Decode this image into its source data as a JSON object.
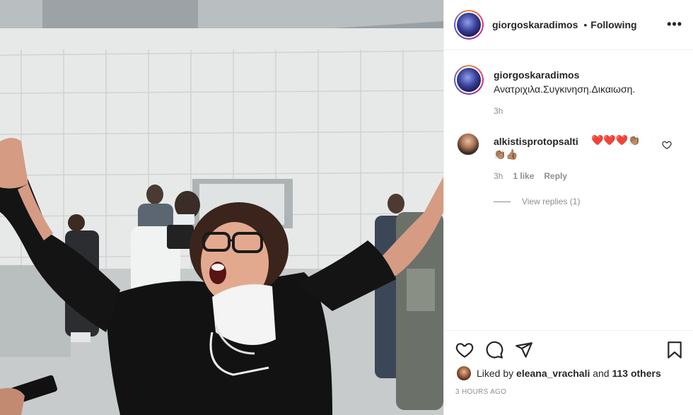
{
  "post": {
    "author": "giorgoskaradimos",
    "separator": "•",
    "follow_status": "Following",
    "more_icon": "more-horizontal-icon"
  },
  "caption": {
    "username": "giorgoskaradimos",
    "text": "Ανατριχιλα.Συγκινηση.Δικαιωση.",
    "time": "3h"
  },
  "comment": {
    "username": "alkistisprotopsalti",
    "text_line1": "❤️❤️❤️👏🏽",
    "text_line2": "👏🏽👍🏽",
    "time": "3h",
    "likes": "1 like",
    "reply_label": "Reply",
    "view_replies": "View replies (1)"
  },
  "actions": {
    "like_icon": "heart-icon",
    "comment_icon": "comment-icon",
    "share_icon": "send-icon",
    "save_icon": "bookmark-icon"
  },
  "likes": {
    "prefix": "Liked by",
    "user": "eleana_vrachali",
    "middle": "and",
    "others": "113 others"
  },
  "age": "3 HOURS AGO",
  "colors": {
    "text": "#262626",
    "muted": "#8e8e8e",
    "border": "#efefef",
    "heart_red": "#ed4956"
  }
}
